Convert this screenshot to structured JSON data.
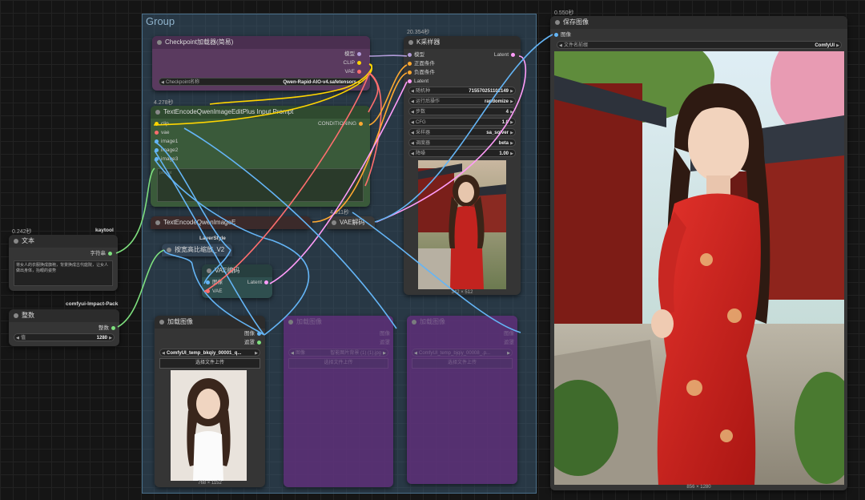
{
  "group": {
    "title": "Group"
  },
  "checkpoint": {
    "title": "Checkpoint加载器(简易)",
    "outputs": [
      "模型",
      "CLIP",
      "VAE"
    ],
    "widget_label": "Checkpoint名称",
    "widget_value": "Qwen-Rapid-AIO-v4.safetensors"
  },
  "text_encode_plus": {
    "timing": "4.278秒",
    "title": "TextEncodeQwenImageEditPlus Input Prompt",
    "inputs": [
      "clip",
      "vae",
      "image1",
      "image2",
      "image3"
    ],
    "output": "CONDITIONING",
    "prompt_placeholder": "prompt"
  },
  "text_encode": {
    "title": "TextEncodeQwenImageE"
  },
  "ksampler": {
    "timing": "20.354秒",
    "title": "K采样器",
    "inputs": [
      "模型",
      "正面条件",
      "负面条件",
      "Latent"
    ],
    "output": "Latent",
    "widgets": [
      {
        "label": "随机种",
        "value": "715570251102149"
      },
      {
        "label": "运行后操作",
        "value": "randomize"
      },
      {
        "label": "步数",
        "value": "4"
      },
      {
        "label": "CFG",
        "value": "1.0"
      },
      {
        "label": "采样器",
        "value": "sa_solver"
      },
      {
        "label": "调度器",
        "value": "beta"
      },
      {
        "label": "降噪",
        "value": "1.00"
      }
    ],
    "image_caption": "342 × 512"
  },
  "vae_decode": {
    "timing": "4.011秒",
    "title": "VAE解码"
  },
  "text_node": {
    "timing": "0.242秒",
    "badge": "kaytool",
    "title": "文本",
    "output": "字符串",
    "content": "将女人的衣服换成旗袍，背景换成古代庭院，让女人做出身体，抬眼的姿势"
  },
  "layer_style": {
    "badge": "LayerStyle",
    "title": "按宽高比缩放_V2"
  },
  "vae_encode": {
    "title": "VAE编码",
    "inputs": [
      "图像",
      "VAE"
    ],
    "output": "Latent"
  },
  "integer_node": {
    "badge": "comfyui-Impact-Pack",
    "title": "整数",
    "output": "整数",
    "widget_label": "值",
    "widget_value": "1280"
  },
  "load_image_1": {
    "title": "加载图像",
    "outputs": [
      "图像",
      "遮罩"
    ],
    "widget_value": "ComfyUI_temp_bkqiy_00001_q...",
    "upload_label": "选择文件上传",
    "image_caption": "768 × 1152"
  },
  "load_image_2": {
    "title": "加载图像",
    "outputs": [
      "图像",
      "遮罩"
    ],
    "widget_label": "图像",
    "widget_value": "智能图片背景 (1) (1).jpg",
    "upload_label": "选择文件上传"
  },
  "load_image_3": {
    "title": "加载图像",
    "outputs": [
      "图像",
      "遮罩"
    ],
    "widget_value": "ComfyUI_temp_bjqiy_00008_.p...",
    "upload_label": "选择文件上传"
  },
  "save_image": {
    "timing": "0.550秒",
    "title": "保存图像",
    "input": "图像",
    "widget_label": "文件名前缀",
    "widget_value": "ComfyUI",
    "image_caption": "856 × 1280"
  },
  "colors": {
    "purple_node": "#5a3a5f",
    "green_node": "#3a5a3a",
    "teal_node": "#2f4f4f",
    "wire_yellow": "#ffd500",
    "wire_pink": "#ff9cf9",
    "wire_blue": "#64b5f6",
    "wire_orange": "#ffa931"
  }
}
